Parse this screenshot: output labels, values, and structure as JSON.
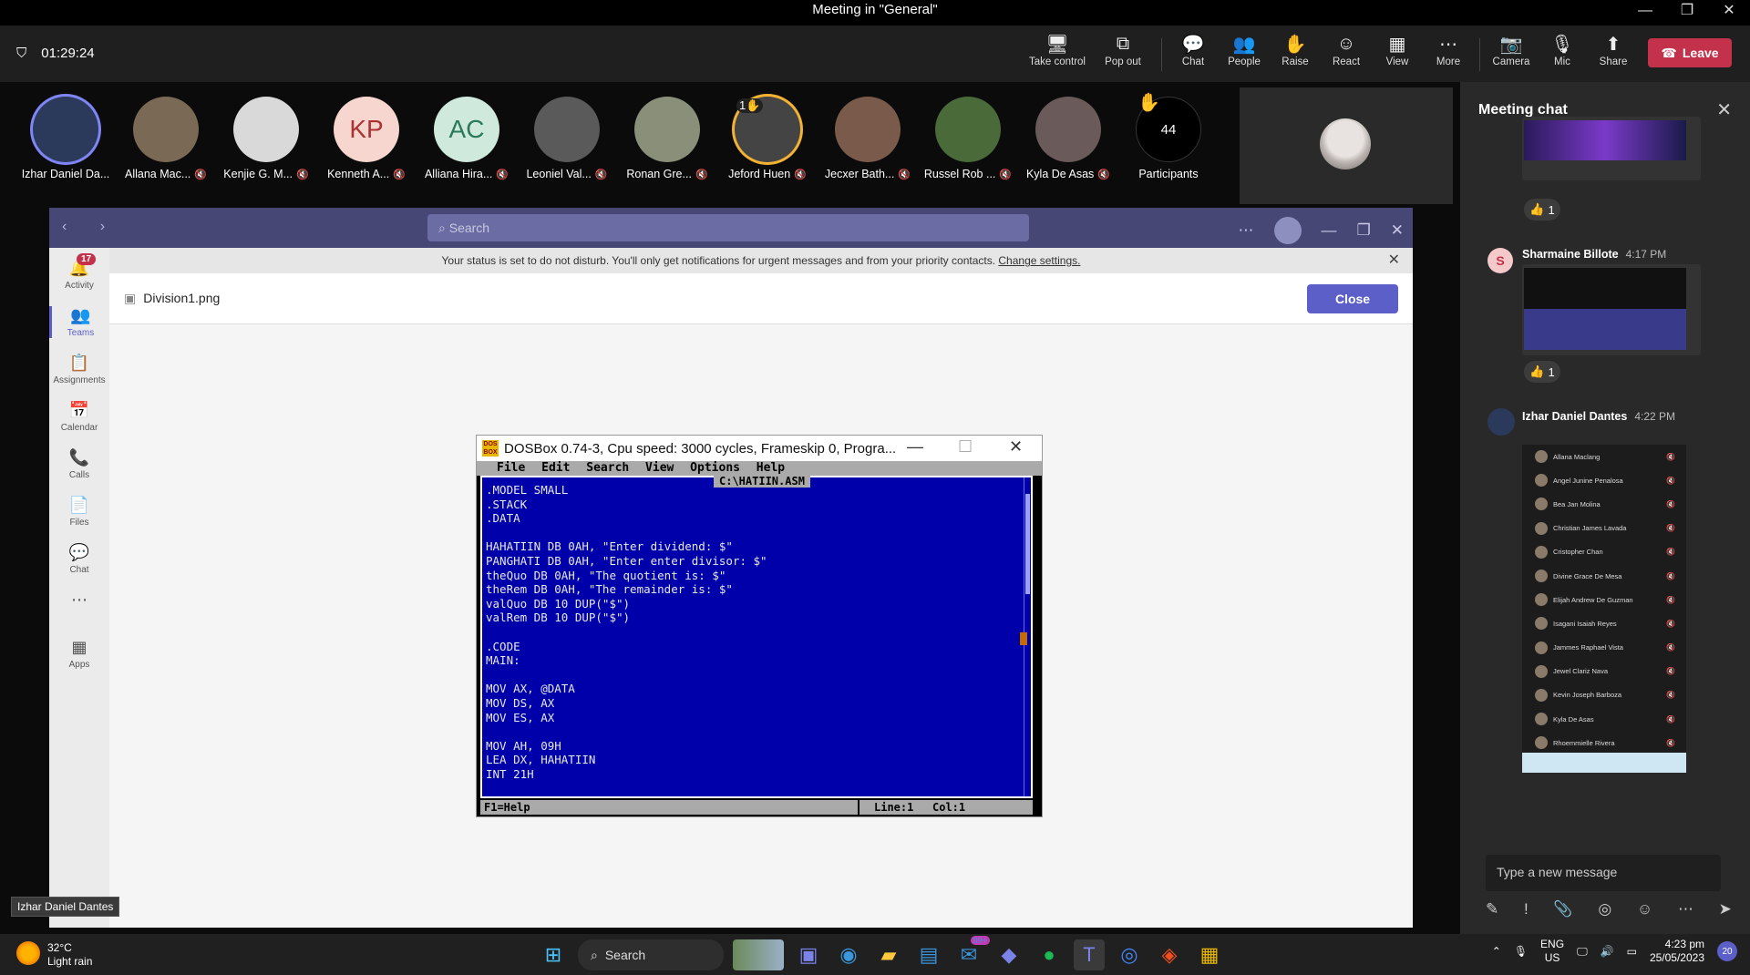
{
  "window": {
    "title": "Meeting in \"General\""
  },
  "meeting": {
    "timer": "01:29:24",
    "controls": [
      {
        "label": "Take control",
        "icon": "take-control-icon",
        "glyph": "🖥"
      },
      {
        "label": "Pop out",
        "icon": "pop-out-icon",
        "glyph": "⧉"
      },
      {
        "label": "Chat",
        "icon": "chat-icon",
        "glyph": "💬"
      },
      {
        "label": "People",
        "icon": "people-icon",
        "glyph": "👥"
      },
      {
        "label": "Raise",
        "icon": "raise-hand-icon",
        "glyph": "✋"
      },
      {
        "label": "React",
        "icon": "react-icon",
        "glyph": "☺"
      },
      {
        "label": "View",
        "icon": "view-icon",
        "glyph": "▦"
      },
      {
        "label": "More",
        "icon": "more-icon",
        "glyph": "⋯"
      },
      {
        "label": "Camera",
        "icon": "camera-off-icon",
        "glyph": "📷"
      },
      {
        "label": "Mic",
        "icon": "mic-off-icon",
        "glyph": "🎙"
      },
      {
        "label": "Share",
        "icon": "share-icon",
        "glyph": "⬆"
      }
    ],
    "leave_label": "Leave",
    "participants": [
      {
        "name": "Izhar Daniel Da...",
        "initials": "",
        "bg": "#2b3a5a",
        "muted": false
      },
      {
        "name": "Allana Mac...",
        "initials": "",
        "bg": "#7a6a55",
        "muted": true
      },
      {
        "name": "Kenjie G. M...",
        "initials": "",
        "bg": "#d9d9d9",
        "muted": true
      },
      {
        "name": "Kenneth A...",
        "initials": "KP",
        "bg": "#f6d6cf",
        "muted": true
      },
      {
        "name": "Alliana Hira...",
        "initials": "AC",
        "bg": "#cfe9dc",
        "muted": true
      },
      {
        "name": "Leoniel Val...",
        "initials": "",
        "bg": "#5a5a5a",
        "muted": true
      },
      {
        "name": "Ronan Gre...",
        "initials": "",
        "bg": "#8a8f7a",
        "muted": true
      },
      {
        "name": "Jeford Huen",
        "initials": "",
        "bg": "#444",
        "muted": true
      },
      {
        "name": "Jecxer Bath...",
        "initials": "",
        "bg": "#7a5a4a",
        "muted": true
      },
      {
        "name": "Russel Rob ...",
        "initials": "",
        "bg": "#4a6a3a",
        "muted": true
      },
      {
        "name": "Kyla De Asas",
        "initials": "",
        "bg": "#6a5a5a",
        "muted": true
      }
    ],
    "raise_count": "1",
    "participants_count": "44",
    "participants_label": "Participants"
  },
  "chat": {
    "title": "Meeting chat",
    "messages": [
      {
        "sender": "",
        "time": "",
        "reaction": "1"
      },
      {
        "sender": "Sharmaine Billote",
        "time": "4:17 PM",
        "avatar": "S",
        "reaction": "1"
      },
      {
        "sender": "Izhar Daniel Dantes",
        "time": "4:22 PM"
      }
    ],
    "shared_list": [
      "Allana Maclang",
      "Angel Junine Penalosa",
      "Bea Jan Molina",
      "Christian James Lavada",
      "Cristopher Chan",
      "Divine Grace De Mesa",
      "Elijah Andrew De Guzman",
      "Isagani Isaiah Reyes",
      "Jammes Raphael Vista",
      "Jewel Clariz Nava",
      "Kevin Joseph Barboza",
      "Kyla De Asas",
      "Rhoemmielle Rivera"
    ],
    "placeholder": "Type a new message"
  },
  "teams": {
    "search_placeholder": "Search",
    "rail": [
      {
        "label": "Activity",
        "icon": "bell-icon",
        "glyph": "🔔",
        "badge": "17"
      },
      {
        "label": "Teams",
        "icon": "teams-icon",
        "glyph": "👥",
        "active": true
      },
      {
        "label": "Assignments",
        "icon": "assignments-icon",
        "glyph": "📋"
      },
      {
        "label": "Calendar",
        "icon": "calendar-icon",
        "glyph": "📅"
      },
      {
        "label": "Calls",
        "icon": "phone-icon",
        "glyph": "📞"
      },
      {
        "label": "Files",
        "icon": "file-icon",
        "glyph": "📄"
      },
      {
        "label": "Chat",
        "icon": "chat-icon",
        "glyph": "💬"
      },
      {
        "label": "",
        "icon": "more-icon",
        "glyph": "⋯"
      },
      {
        "label": "Apps",
        "icon": "apps-icon",
        "glyph": "▦"
      }
    ],
    "notice": "Your status is set to do not disturb. You'll only get notifications for urgent messages and from your priority contacts.",
    "notice_link": "Change settings.",
    "file_name": "Division1.png",
    "close_label": "Close"
  },
  "dosbox": {
    "title": "DOSBox 0.74-3, Cpu speed:     3000 cycles, Frameskip  0, Progra...",
    "menu": "File  Edit  Search  View  Options  Help",
    "file": "C:\\HATIIN.ASM",
    "code": ".MODEL SMALL\n.STACK\n.DATA\n\nHAHATIIN DB 0AH, \"Enter dividend: $\"\nPANGHATI DB 0AH, \"Enter enter divisor: $\"\ntheQuo DB 0AH, \"The quotient is: $\"\ntheRem DB 0AH, \"The remainder is: $\"\nvalQuo DB 10 DUP(\"$\")\nvalRem DB 10 DUP(\"$\")\n\n.CODE\nMAIN:\n\nMOV AX, @DATA\nMOV DS, AX\nMOV ES, AX\n\nMOV AH, 09H\nLEA DX, HAHATIIN\nINT 21H",
    "help": "F1=Help",
    "line": "Line:1",
    "col": "Col:1"
  },
  "tooltip": "Izhar Daniel Dantes",
  "taskbar": {
    "temp": "32°C",
    "weather": "Light rain",
    "search": "Search",
    "lang1": "ENG",
    "lang2": "US",
    "time": "4:23 pm",
    "date": "25/05/2023",
    "notif": "20",
    "mail_badge": "99+"
  },
  "colors": {
    "leave": "#c4314b",
    "teams_brand": "#5b5fc7",
    "dos_blue": "#0000aa"
  }
}
